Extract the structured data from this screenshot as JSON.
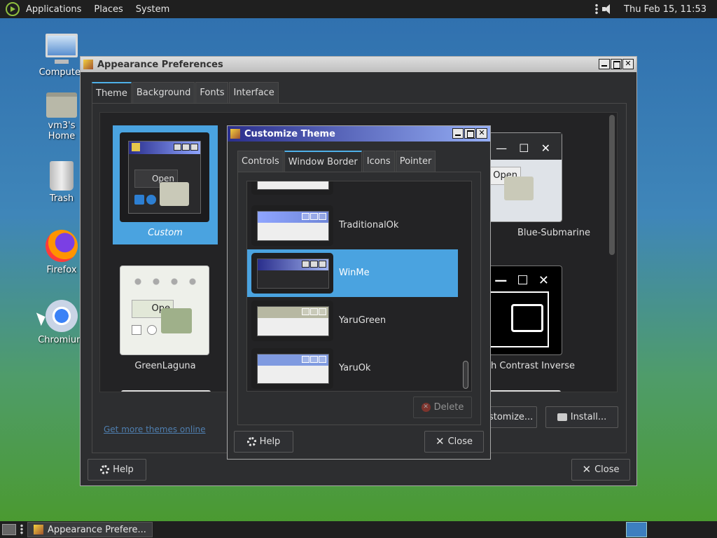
{
  "top_panel": {
    "menus": [
      "Applications",
      "Places",
      "System"
    ],
    "clock": "Thu Feb 15, 11:53"
  },
  "desktop_icons": [
    {
      "label": "Computer",
      "icon": "computer-icon"
    },
    {
      "label": "vm3's Home",
      "icon": "home-folder-icon"
    },
    {
      "label": "Trash",
      "icon": "trash-icon"
    },
    {
      "label": "Firefox",
      "icon": "firefox-icon"
    },
    {
      "label": "Chromium",
      "icon": "chromium-icon"
    }
  ],
  "appearance_window": {
    "title": "Appearance Preferences",
    "tabs": [
      "Theme",
      "Background",
      "Fonts",
      "Interface"
    ],
    "active_tab": "Theme",
    "themes": [
      {
        "name": "Custom",
        "selected": true
      },
      {
        "name": "Blue-Submarine",
        "selected": false
      },
      {
        "name": "GreenLaguna",
        "selected": false
      },
      {
        "name": "High Contrast Inverse",
        "selected": false
      }
    ],
    "get_more_link": "Get more themes online",
    "customize_label": "Customize...",
    "install_label": "Install...",
    "help_label": "Help",
    "close_label": "Close"
  },
  "customize_window": {
    "title": "Customize Theme",
    "tabs": [
      "Controls",
      "Window Border",
      "Icons",
      "Pointer"
    ],
    "active_tab": "Window Border",
    "border_themes": [
      {
        "name": "TraditionalOk",
        "selected": false,
        "bar_color": "#6f86d8"
      },
      {
        "name": "WinMe",
        "selected": true,
        "bar_color": "#2a2e8c"
      },
      {
        "name": "YaruGreen",
        "selected": false,
        "bar_color": "#b7b8a2"
      },
      {
        "name": "YaruOk",
        "selected": false,
        "bar_color": "#7f9ae0"
      }
    ],
    "delete_label": "Delete",
    "help_label": "Help",
    "close_label": "Close"
  },
  "taskbar": {
    "task_label": "Appearance Prefere..."
  },
  "colors": {
    "selection": "#4aa3e0",
    "panel": "#1f1f1f",
    "window_bg": "#2d2e30"
  }
}
